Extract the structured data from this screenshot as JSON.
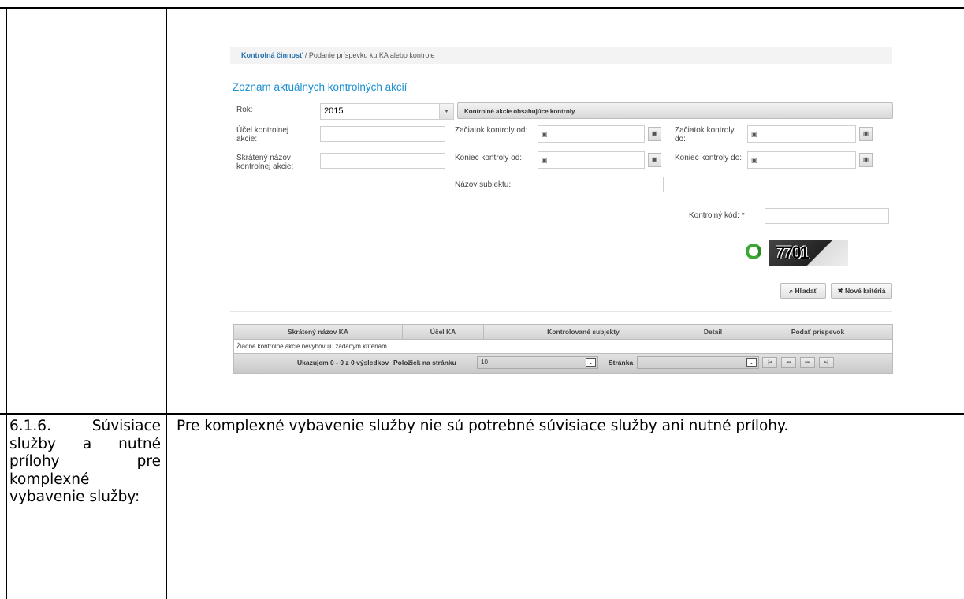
{
  "screenshot": {
    "breadcrumb": {
      "link": "Kontrolná činnosť",
      "separator": " / ",
      "current": "Podanie príspevku ku KA alebo kontrole"
    },
    "title": "Zoznam aktuálnych kontrolných akcií",
    "form": {
      "rok_label": "Rok:",
      "rok_value": "2015",
      "filter_tab": "Kontrolné akcie obsahujúce kontroly",
      "ucel_label": "Účel kontrolnej akcie:",
      "skrateny_label": "Skrátený názov kontrolnej akcie:",
      "zaciatok_od_label": "Začiatok kontroly od:",
      "koniec_od_label": "Koniec kontroly od:",
      "zaciatok_do_label": "Začiatok kontroly do:",
      "koniec_do_label": "Koniec kontroly do:",
      "nazov_subjektu_label": "Názov subjektu:",
      "kontrolny_kod_label": "Kontrolný kód: *",
      "captcha_text": "7701"
    },
    "buttons": {
      "search": "Hľadať",
      "new_criteria": "Nové kritériá"
    },
    "grid": {
      "columns": [
        "Skrátený názov KA",
        "Účel KA",
        "Kontrolované subjekty",
        "Detail",
        "Podať príspevok"
      ],
      "empty_message": "Žiadne kontrolné akcie nevyhovujú zadaným kritériám",
      "footer": {
        "summary": "Ukazujem 0 - 0 z 0 výsledkov",
        "per_page_label": "Položiek na stránku",
        "per_page_value": "10",
        "page_label": "Stránka"
      }
    }
  },
  "row2": {
    "label": "6.1.6. Súvisiace služby a nutné prílohy pre komplexné vybavenie služby:",
    "text": "Pre komplexné vybavenie služby nie sú potrebné súvisiace služby ani nutné prílohy."
  }
}
